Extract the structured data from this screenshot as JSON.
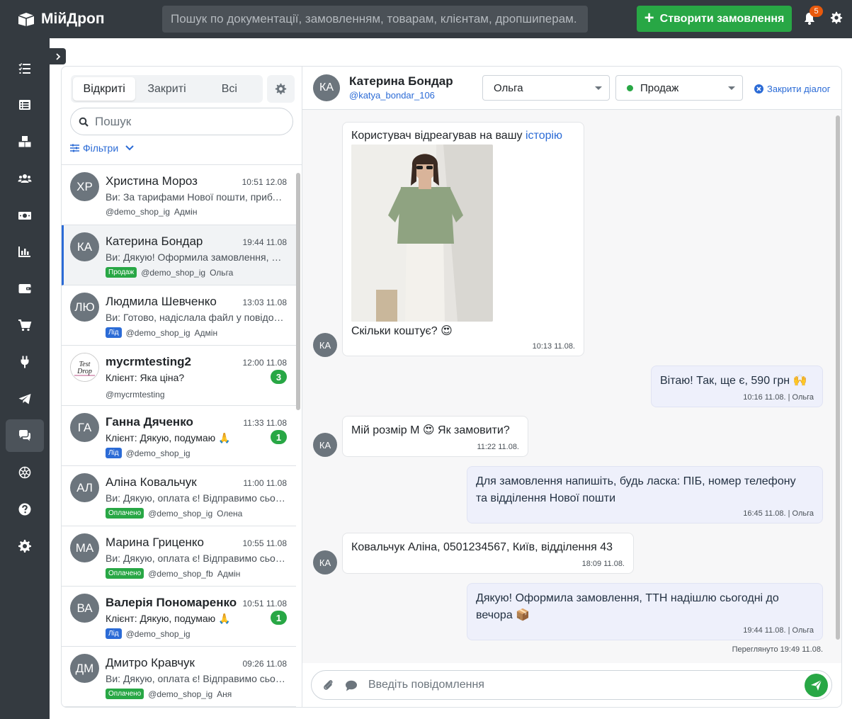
{
  "app": {
    "name": "МійДроп",
    "search_placeholder": "Пошук по документації, замовленням, товарам, клієнтам, дропшиперам.",
    "create_order_label": "Створити замовлення",
    "notifications_count": "5"
  },
  "accent_color": "#28a745",
  "link_color": "#2b6bd6",
  "sidebar": {
    "items": [
      {
        "name": "tasks-icon"
      },
      {
        "name": "list-icon"
      },
      {
        "name": "boxes-icon"
      },
      {
        "name": "users-icon"
      },
      {
        "name": "money-icon"
      },
      {
        "name": "chart-icon"
      },
      {
        "name": "wallet-icon"
      },
      {
        "name": "cart-icon"
      },
      {
        "name": "plug-icon"
      },
      {
        "name": "telegram-icon"
      },
      {
        "name": "chat-icon",
        "active": true
      },
      {
        "name": "ai-icon"
      },
      {
        "name": "help-icon"
      },
      {
        "name": "settings-icon"
      }
    ]
  },
  "conversations": {
    "tabs": [
      "Відкриті",
      "Закриті",
      "Всі"
    ],
    "active_tab": "Відкриті",
    "search_placeholder": "Пошук",
    "filters_label": "Фільтри",
    "items": [
      {
        "initials": "ХР",
        "name": "Христина Мороз",
        "time": "10:51 12.08",
        "preview": "Ви: За тарифами Нової пошти, приблизно...",
        "tag": "",
        "shop": "@demo_shop_ig",
        "manager": "Адмін",
        "unread": ""
      },
      {
        "initials": "КА",
        "name": "Катерина Бондар",
        "time": "19:44 11.08",
        "preview": "Ви: Дякую! Оформила замовлення, ТТН надішлю",
        "tag": "Продаж",
        "shop": "@demo_shop_ig",
        "manager": "Ольга",
        "unread": ""
      },
      {
        "initials": "ЛЮ",
        "name": "Людмила Шевченко",
        "time": "13:03 11.08",
        "preview": "Ви: Готово, надіслала файл у повідомленні",
        "tag": "Лід",
        "shop": "@demo_shop_ig",
        "manager": "Адмін",
        "unread": ""
      },
      {
        "initials": "",
        "name": "mycrmtesting2",
        "time": "12:00 11.08",
        "preview": "Клієнт: Яка ціна?",
        "tag": "",
        "shop": "@mycrmtesting",
        "manager": "",
        "unread": "3"
      },
      {
        "initials": "ГА",
        "name": "Ганна Дяченко",
        "time": "11:33 11.08",
        "preview": "Клієнт: Дякую, подумаю 🙏",
        "tag": "Лід",
        "shop": "@demo_shop_ig",
        "manager": "",
        "unread": "1"
      },
      {
        "initials": "АЛ",
        "name": "Аліна Ковальчук",
        "time": "11:00 11.08",
        "preview": "Ви: Дякую, оплата є! Відправимо сьогодні",
        "tag": "Оплачено",
        "shop": "@demo_shop_ig",
        "manager": "Олена",
        "unread": ""
      },
      {
        "initials": "МА",
        "name": "Марина Гриценко",
        "time": "10:55 11.08",
        "preview": "Ви: Дякую, оплата є! Відправимо сьогодні",
        "tag": "Оплачено",
        "shop": "@demo_shop_fb",
        "manager": "Адмін",
        "unread": ""
      },
      {
        "initials": "ВА",
        "name": "Валерія Пономаренко",
        "time": "10:51 11.08",
        "preview": "Клієнт: Дякую, подумаю 🙏",
        "tag": "Лід",
        "shop": "@demo_shop_ig",
        "manager": "",
        "unread": "1"
      },
      {
        "initials": "ДМ",
        "name": "Дмитро Кравчук",
        "time": "09:26 11.08",
        "preview": "Ви: Дякую, оплата є! Відправимо сьогодні",
        "tag": "Оплачено",
        "shop": "@demo_shop_ig",
        "manager": "Аня",
        "unread": ""
      }
    ],
    "avatar_logo_text": "Test Drop"
  },
  "chat": {
    "contact_initials": "КА",
    "contact_name": "Катерина Бондар",
    "contact_handle": "@katya_bondar_106",
    "manager_select": "Ольга",
    "status_select": "Продаж",
    "close_dialog_label": "Закрити діалог",
    "messages": [
      {
        "dir": "in",
        "text_before": "Користувач відреагував на вашу ",
        "link": "історію",
        "caption": "Скільки коштує? 😍",
        "time": "10:13 11.08."
      },
      {
        "dir": "out",
        "text": "Вітаю! Так, ще є, 590 грн 🙌",
        "time": "10:16 11.08. | Ольга"
      },
      {
        "dir": "in",
        "text": "Мій розмір М 😍 Як замовити?",
        "time": "11:22 11.08."
      },
      {
        "dir": "out",
        "line1": "Для замовлення напишіть, будь ласка: ПІБ, номер телефону",
        "line2": "та відділення Нової пошти",
        "time": "16:45 11.08. | Ольга"
      },
      {
        "dir": "in",
        "text": "Ковальчук Аліна, 0501234567, Київ, відділення 43",
        "time": "18:09 11.08."
      },
      {
        "dir": "out",
        "line1": "Дякую! Оформила замовлення, ТТН надішлю сьогодні до",
        "line2": "вечора 📦",
        "time": "19:44 11.08. | Ольга"
      }
    ],
    "seen_label": "Переглянуто 19:49 11.08.",
    "composer_placeholder": "Введіть повідомлення"
  }
}
